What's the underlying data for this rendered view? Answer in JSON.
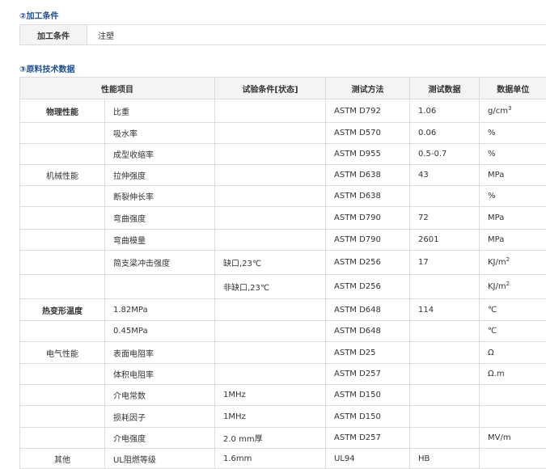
{
  "processing": {
    "title": "②加工条件",
    "label": "加工条件",
    "value": "注塑"
  },
  "raw_data": {
    "title": "③原料技术数据",
    "headers": [
      "性能项目",
      "试验条件[状态]",
      "测试方法",
      "测试数据",
      "数据单位"
    ],
    "rows": [
      {
        "category": "物理性能",
        "category_bold": true,
        "item": "比重",
        "condition": "",
        "method": "ASTM D792",
        "value": "1.06",
        "unit": "g/cm",
        "unit_sup": "3"
      },
      {
        "category": "",
        "item": "吸水率",
        "condition": "",
        "method": "ASTM D570",
        "value": "0.06",
        "unit": "%"
      },
      {
        "category": "",
        "item": "成型收缩率",
        "condition": "",
        "method": "ASTM D955",
        "value": "0.5-0.7",
        "unit": "%"
      },
      {
        "category": "机械性能",
        "category_bold": false,
        "item": "拉伸强度",
        "condition": "",
        "method": "ASTM D638",
        "value": "43",
        "unit": "MPa"
      },
      {
        "category": "",
        "item": "断裂伸长率",
        "condition": "",
        "method": "ASTM D638",
        "value": "",
        "unit": "%"
      },
      {
        "category": "",
        "item": "弯曲强度",
        "condition": "",
        "method": "ASTM D790",
        "value": "72",
        "unit": "MPa"
      },
      {
        "category": "",
        "item": "弯曲模量",
        "condition": "",
        "method": "ASTM D790",
        "value": "2601",
        "unit": "MPa"
      },
      {
        "category": "",
        "item": "简支梁冲击强度",
        "condition": "缺口,23℃",
        "method": "ASTM D256",
        "value": "17",
        "unit": "KJ/m",
        "unit_sup": "2"
      },
      {
        "category": "",
        "item": "",
        "condition": "非缺口,23℃",
        "method": "ASTM D256",
        "value": "",
        "unit": "KJ/m",
        "unit_sup": "2"
      },
      {
        "category": "热变形温度",
        "category_bold": true,
        "item": "1.82MPa",
        "condition": "",
        "method": "ASTM D648",
        "value": "114",
        "unit": "℃"
      },
      {
        "category": "",
        "item": "0.45MPa",
        "condition": "",
        "method": "ASTM D648",
        "value": "",
        "unit": "℃"
      },
      {
        "category": "电气性能",
        "category_bold": false,
        "item": "表面电阻率",
        "condition": "",
        "method": "ASTM D25",
        "value": "",
        "unit": "Ω"
      },
      {
        "category": "",
        "item": "体积电阻率",
        "condition": "",
        "method": "ASTM D257",
        "value": "",
        "unit": "Ω.m"
      },
      {
        "category": "",
        "item": "介电常数",
        "condition": "1MHz",
        "method": "ASTM D150",
        "value": "",
        "unit": ""
      },
      {
        "category": "",
        "item": "损耗因子",
        "condition": "1MHz",
        "method": "ASTM D150",
        "value": "",
        "unit": ""
      },
      {
        "category": "",
        "item": "介电强度",
        "condition": "2.0 mm厚",
        "method": "ASTM D257",
        "value": "",
        "unit": "MV/m"
      },
      {
        "category": "其他",
        "category_bold": false,
        "item": "UL阻燃等级",
        "condition": "1.6mm",
        "method": "UL94",
        "value": "HB",
        "unit": ""
      }
    ]
  }
}
